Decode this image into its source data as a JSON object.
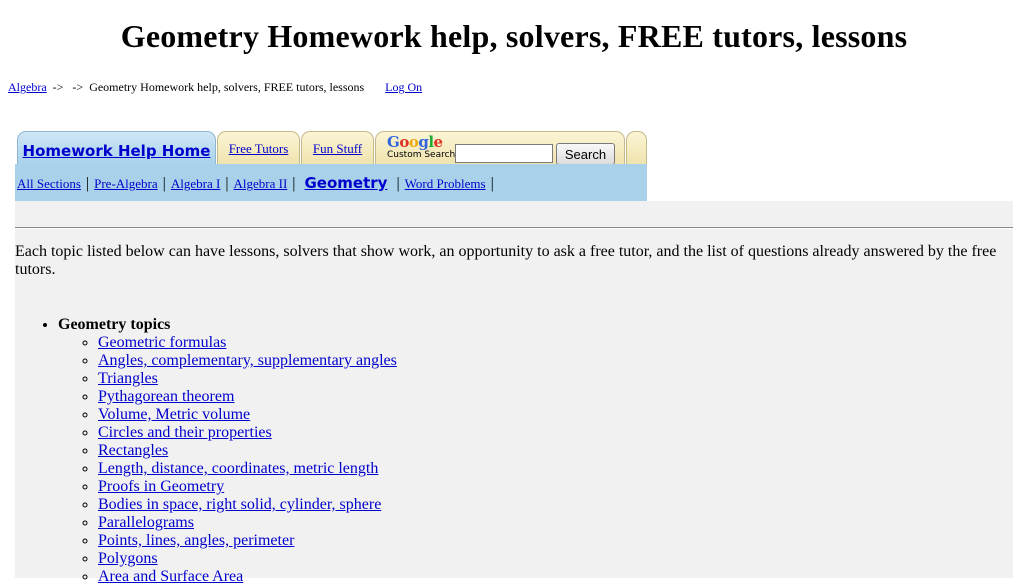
{
  "page": {
    "title": "Geometry Homework help, solvers, FREE tutors, lessons"
  },
  "breadcrumb": {
    "root_link": "Algebra",
    "separator1": "->",
    "separator2": "->",
    "current": "Geometry Homework help, solvers, FREE tutors, lessons",
    "login_link": "Log On"
  },
  "tabs": {
    "home": "Homework Help Home",
    "tutors": "Free Tutors",
    "fun": "Fun Stuff",
    "google_logo": "Google",
    "google_sub": "Custom Search",
    "search_value": "",
    "search_button": "Search"
  },
  "subnav": {
    "items": [
      "All Sections",
      "Pre-Algebra",
      "Algebra I",
      "Algebra II",
      "Geometry",
      "Word Problems"
    ],
    "pipe": "|",
    "active": "Geometry"
  },
  "content": {
    "intro": "Each topic listed below can have lessons, solvers that show work, an opportunity to ask a free tutor, and the list of questions already answered by the free tutors.",
    "section_heading": "Geometry topics",
    "topics": [
      "Geometric formulas",
      "Angles, complementary, supplementary angles",
      "Triangles",
      "Pythagorean theorem",
      "Volume, Metric volume",
      "Circles and their properties",
      "Rectangles",
      "Length, distance, coordinates, metric length",
      "Proofs in Geometry",
      "Bodies in space, right solid, cylinder, sphere",
      "Parallelograms",
      "Points, lines, angles, perimeter",
      "Polygons",
      "Area and Surface Area"
    ]
  },
  "colors": {
    "link": "#0000cc",
    "tab_gold": "#efe3ad",
    "tab_blue": "#a9d2ea",
    "content_bg": "#f1f1f1"
  }
}
